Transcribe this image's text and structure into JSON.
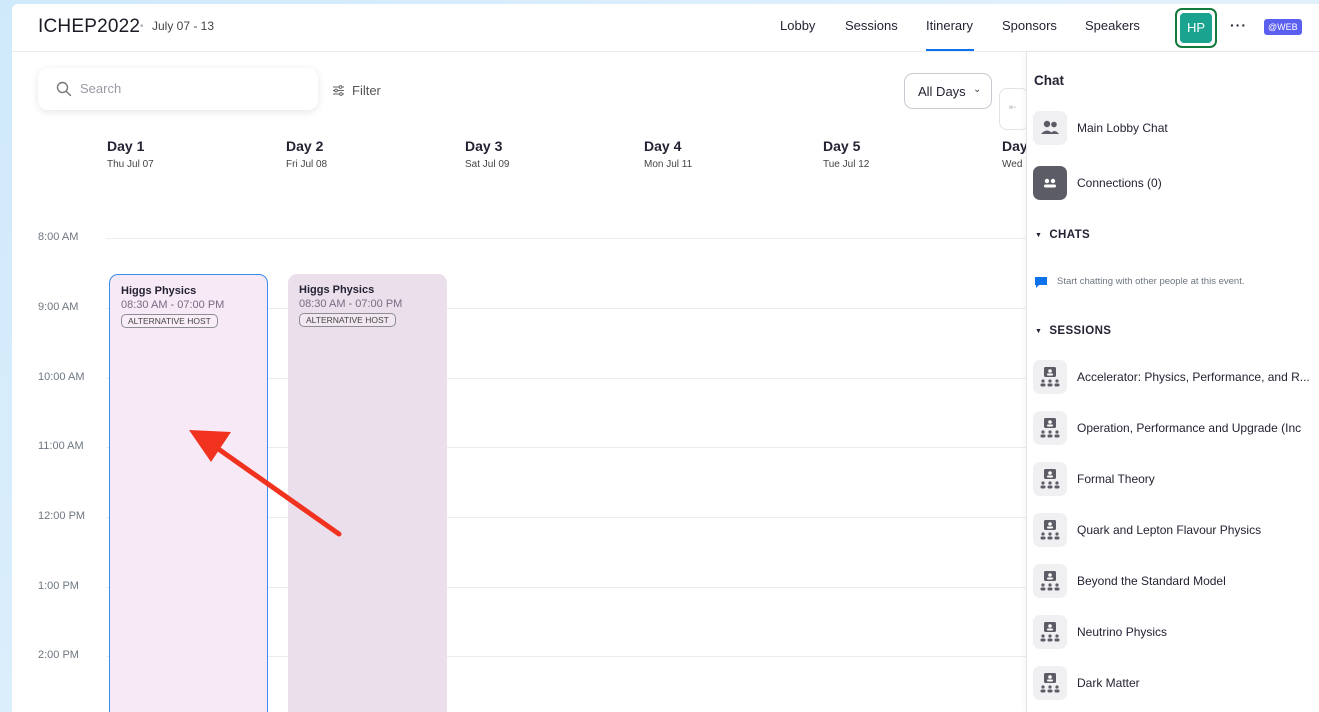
{
  "header": {
    "title": "ICHEP2022",
    "separator": "•",
    "dates": "July 07 - 13",
    "nav": [
      "Lobby",
      "Sessions",
      "Itinerary",
      "Sponsors",
      "Speakers"
    ],
    "active_tab": "Itinerary",
    "avatar_initials": "HP",
    "more": "···",
    "badge": "@WEB"
  },
  "toolbar": {
    "search_placeholder": "Search",
    "filter_label": "Filter",
    "day_select": "All Days"
  },
  "days": [
    {
      "name": "Day 1",
      "date": "Thu Jul 07"
    },
    {
      "name": "Day 2",
      "date": "Fri Jul 08"
    },
    {
      "name": "Day 3",
      "date": "Sat Jul 09"
    },
    {
      "name": "Day 4",
      "date": "Mon Jul 11"
    },
    {
      "name": "Day 5",
      "date": "Tue Jul 12"
    },
    {
      "name": "Day",
      "date": "Wed"
    }
  ],
  "times": [
    "8:00 AM",
    "9:00 AM",
    "10:00 AM",
    "11:00 AM",
    "12:00 PM",
    "1:00 PM",
    "2:00 PM"
  ],
  "events": [
    {
      "title": "Higgs Physics",
      "time": "08:30 AM - 07:00 PM",
      "tag": "ALTERNATIVE HOST"
    },
    {
      "title": "Higgs Physics",
      "time": "08:30 AM - 07:00 PM",
      "tag": "ALTERNATIVE HOST"
    }
  ],
  "chat": {
    "title": "Chat",
    "main_lobby": "Main Lobby Chat",
    "connections": "Connections (0)",
    "chats_heading": "CHATS",
    "chats_empty": "Start chatting with other people at this event.",
    "sessions_heading": "SESSIONS",
    "sessions": [
      "Accelerator: Physics, Performance, and R...",
      "Operation, Performance and Upgrade (Inc",
      "Formal Theory",
      "Quark and Lepton Flavour Physics",
      "Beyond the Standard Model",
      "Neutrino Physics",
      "Dark Matter"
    ]
  },
  "colors": {
    "accent": "#0e72ed",
    "avatar": "#1aa48f",
    "badge": "#5b5ff0",
    "event_selected": "#f7e9f6",
    "event_other": "#ecdfec",
    "annotation_arrow": "#f0321e"
  }
}
